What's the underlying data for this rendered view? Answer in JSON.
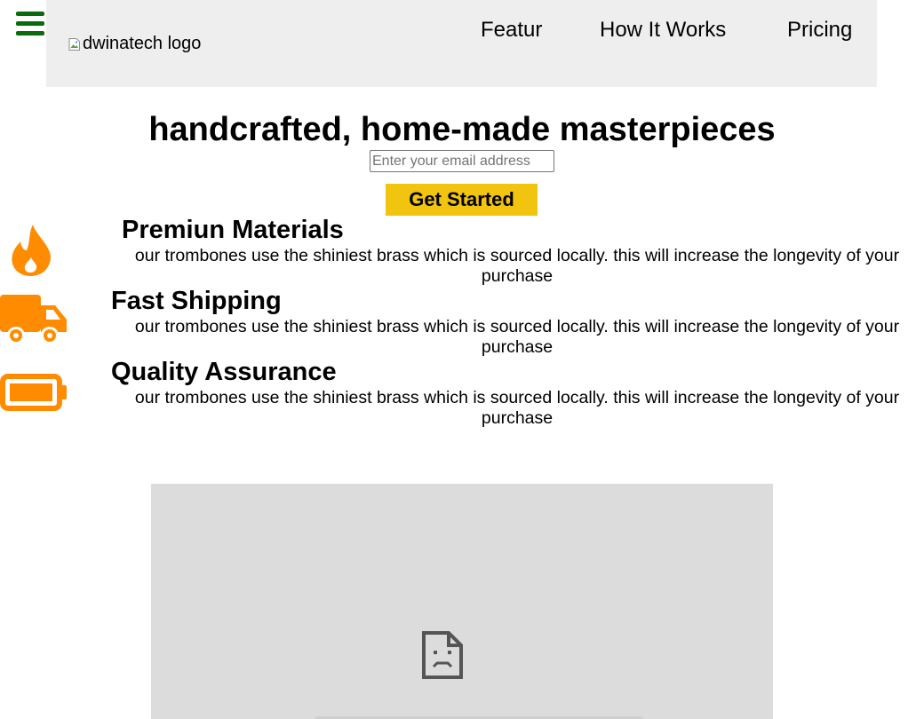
{
  "colors": {
    "hamburger": "#0a6b0a",
    "header_bg": "#eeeeee",
    "cta_bg": "#f1c40f",
    "icon_orange": "#ff8c00",
    "video_bg": "#dcdcdc"
  },
  "menu": {
    "icon": "hamburger-menu-icon"
  },
  "header": {
    "logo_alt": "dwinatech logo",
    "nav": [
      {
        "label": "Featur"
      },
      {
        "label": "How It Works"
      },
      {
        "label": "Pricing"
      }
    ]
  },
  "hero": {
    "title": "handcrafted, home-made masterpieces",
    "email_placeholder": "Enter your email address",
    "email_value": "",
    "cta_label": "Get Started"
  },
  "features": [
    {
      "icon": "fire-icon",
      "title": "Premiun Materials",
      "description": "our trombones use the shiniest brass which is sourced locally. this will increase the longevity of your purchase"
    },
    {
      "icon": "truck-icon",
      "title": "Fast Shipping",
      "description": "our trombones use the shiniest brass which is sourced locally. this will increase the longevity of your purchase"
    },
    {
      "icon": "battery-full-icon",
      "title": "Quality Assurance",
      "description": "our trombones use the shiniest brass which is sourced locally. this will increase the longevity of your purchase"
    }
  ],
  "video": {
    "icon": "sad-page-icon"
  }
}
